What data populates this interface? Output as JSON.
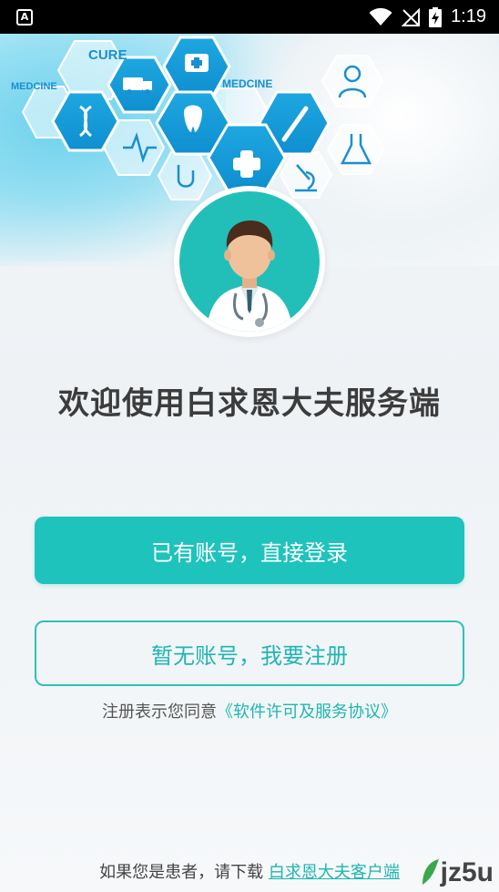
{
  "status_bar": {
    "time": "1:19",
    "app_icon_letter": "A"
  },
  "banner": {
    "hex_labels": [
      "CURE",
      "MEDCINE",
      "MEDCINE"
    ],
    "accent": "#1ec3bc"
  },
  "welcome": {
    "title": "欢迎使用白求恩大夫服务端"
  },
  "actions": {
    "login_label": "已有账号，直接登录",
    "register_label": "暂无账号，我要注册"
  },
  "agreement": {
    "prefix": "注册表示您同意",
    "link": "《软件许可及服务协议》"
  },
  "footer": {
    "prefix": "如果您是患者，请下载",
    "link": "白求恩大夫客户端"
  },
  "watermark": {
    "text": "jz5u"
  }
}
